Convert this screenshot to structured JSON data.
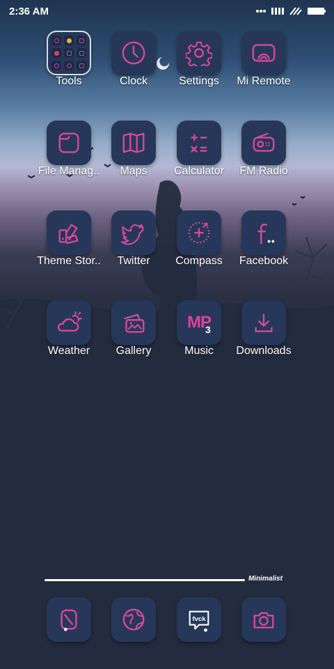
{
  "status_bar": {
    "time": "2:36 AM"
  },
  "colors": {
    "accent": "#d8479f",
    "tile": "#26375a",
    "background": "#232c3e"
  },
  "apps": [
    {
      "label": "Tools",
      "icon": "folder-tools-icon"
    },
    {
      "label": "Clock",
      "icon": "clock-icon"
    },
    {
      "label": "Settings",
      "icon": "gear-icon"
    },
    {
      "label": "Mi Remote",
      "icon": "remote-cast-icon"
    },
    {
      "label": "File Manag..",
      "icon": "folder-icon"
    },
    {
      "label": "Maps",
      "icon": "map-icon"
    },
    {
      "label": "Calculator",
      "icon": "calculator-icon"
    },
    {
      "label": "FM Radio",
      "icon": "radio-icon"
    },
    {
      "label": "Theme Stor..",
      "icon": "palette-icon"
    },
    {
      "label": "Twitter",
      "icon": "twitter-bird-icon"
    },
    {
      "label": "Compass",
      "icon": "compass-icon"
    },
    {
      "label": "Facebook",
      "icon": "facebook-icon"
    },
    {
      "label": "Weather",
      "icon": "weather-cloud-sun-icon"
    },
    {
      "label": "Gallery",
      "icon": "gallery-icon"
    },
    {
      "label": "Music",
      "icon": "music-mp3-icon",
      "glyph": "MP",
      "glyph_sub": "3"
    },
    {
      "label": "Downloads",
      "icon": "download-icon"
    }
  ],
  "page_indicator": {
    "label": "Minimalist"
  },
  "dock": [
    {
      "icon": "phone-icon"
    },
    {
      "icon": "globe-browser-icon"
    },
    {
      "icon": "messaging-icon",
      "text": "fvck"
    },
    {
      "icon": "camera-icon"
    }
  ]
}
